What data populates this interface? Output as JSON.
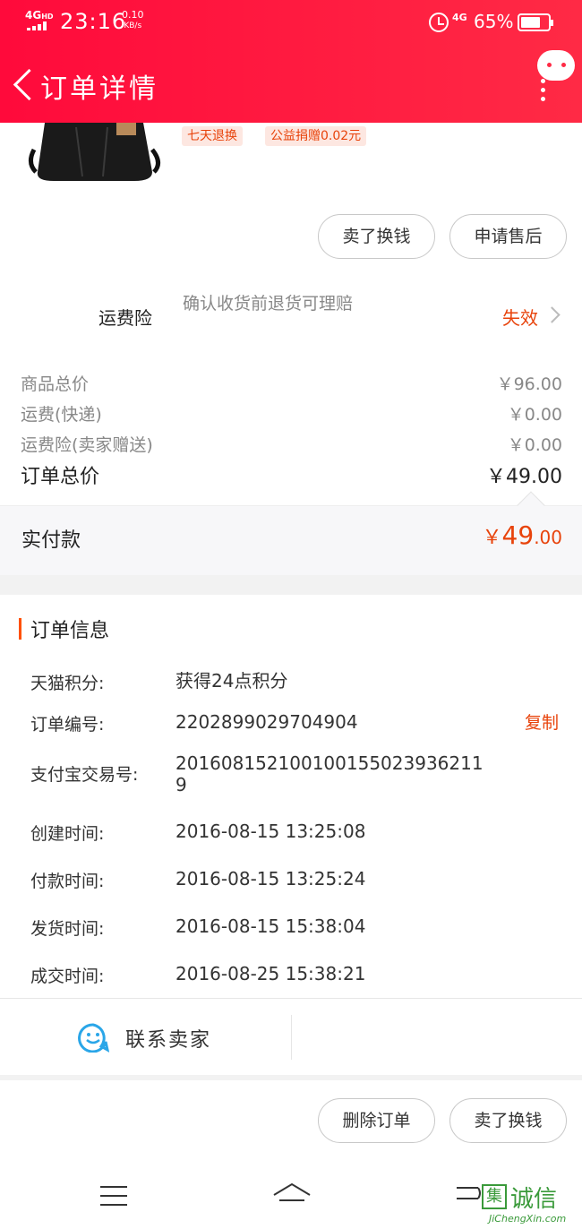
{
  "status_bar": {
    "network": "4G",
    "network_sup": "HD",
    "time": "23:16",
    "speed_value": "0.10",
    "speed_unit": "KB/s",
    "network2": "4G",
    "battery": "65%"
  },
  "header": {
    "title": "订单详情"
  },
  "product": {
    "tag_return": "七天退换",
    "tag_charity": "公益捐赠0.02元",
    "btn_sell": "卖了换钱",
    "btn_after_sale": "申请售后"
  },
  "insurance": {
    "label": "运费险",
    "description": "确认收货前退货可理赔",
    "status": "失效"
  },
  "prices": {
    "rows": [
      {
        "label": "商品总价",
        "value": "￥96.00"
      },
      {
        "label": "运费(快递)",
        "value": "￥0.00"
      },
      {
        "label": "运费险(卖家赠送)",
        "value": "￥0.00"
      }
    ],
    "total_label": "订单总价",
    "total_value": "￥49.00"
  },
  "paid": {
    "label": "实付款",
    "currency": "￥",
    "integer": "49",
    "decimal": ".00"
  },
  "order_info": {
    "title": "订单信息",
    "rows": [
      {
        "key": "天猫积分:",
        "value": "获得24点积分"
      },
      {
        "key": "订单编号:",
        "value": "2202899029704904"
      },
      {
        "key": "支付宝交易号:",
        "value": "2016081521001001550239362119"
      },
      {
        "key": "创建时间:",
        "value": "2016-08-15 13:25:08"
      },
      {
        "key": "付款时间:",
        "value": "2016-08-15 13:25:24"
      },
      {
        "key": "发货时间:",
        "value": "2016-08-15 15:38:04"
      },
      {
        "key": "成交时间:",
        "value": "2016-08-25 15:38:21"
      }
    ],
    "copy_label": "复制"
  },
  "contact": {
    "label": "联系卖家"
  },
  "actions": {
    "delete_label": "删除订单",
    "sell_label": "卖了换钱"
  },
  "watermark": {
    "icon_char": "集",
    "text": "诚信",
    "url": "JiChengXin.com"
  },
  "colors": {
    "header": "#ff1a40",
    "accent": "#e8430b",
    "smile": "#2aa6e8"
  }
}
